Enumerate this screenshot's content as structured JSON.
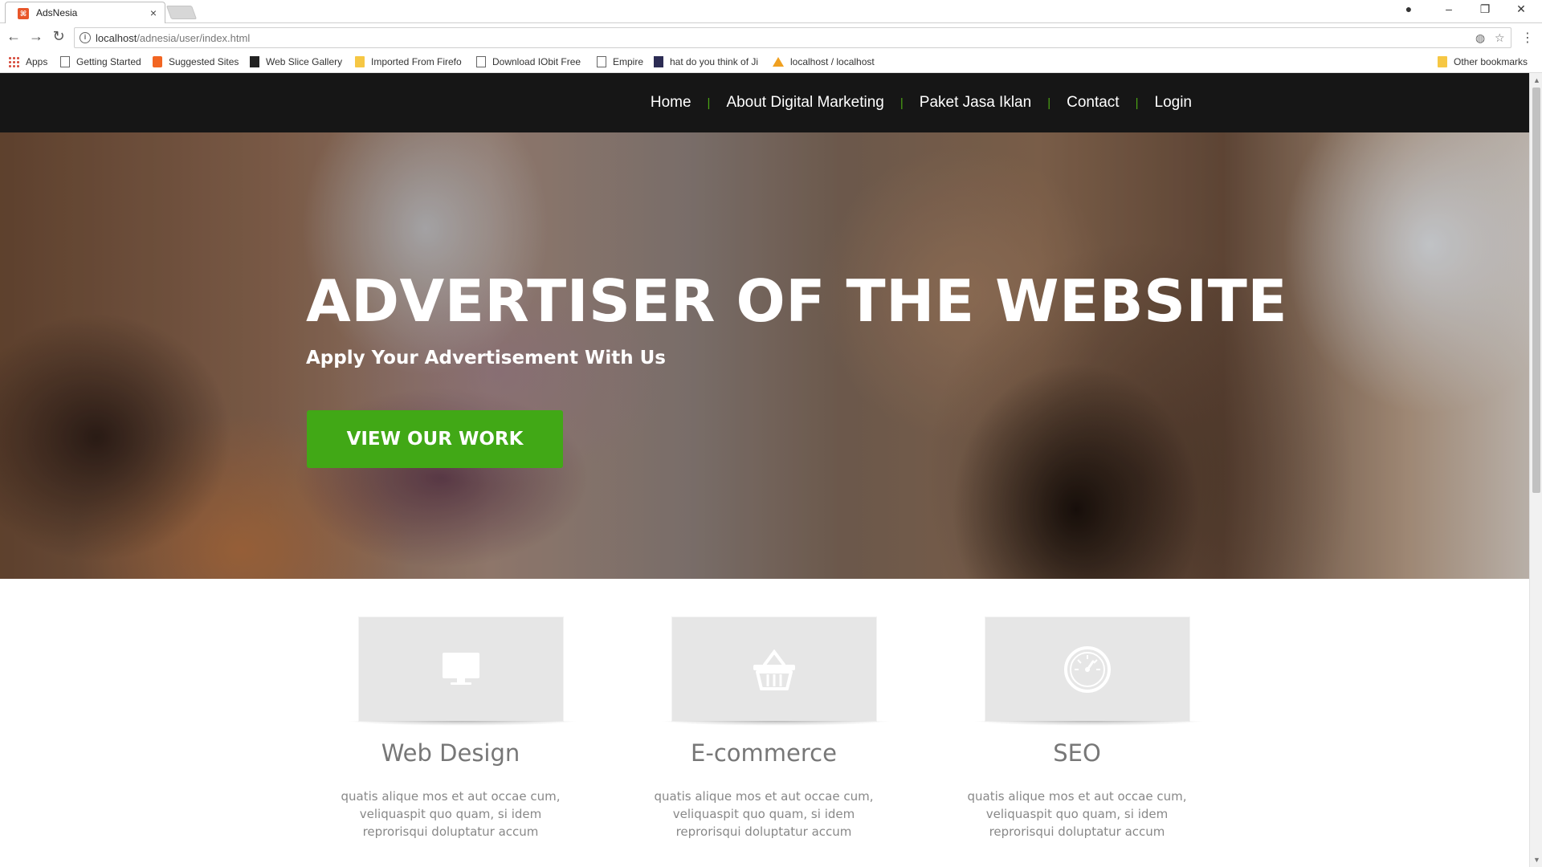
{
  "browser": {
    "tab_title": "AdsNesia",
    "tab_close": "×",
    "url_host": "localhost",
    "url_path": "/adnesia/user/index.html",
    "bookmarks": [
      {
        "label": "Apps",
        "icon": "apps-icon"
      },
      {
        "label": "Getting Started",
        "icon": "page-icon"
      },
      {
        "label": "Suggested Sites",
        "icon": "suggested-sites-icon"
      },
      {
        "label": "Web Slice Gallery",
        "icon": "web-slice-icon"
      },
      {
        "label": "Imported From Firefo",
        "icon": "folder-icon"
      },
      {
        "label": "Download IObit Free",
        "icon": "page-icon"
      },
      {
        "label": "Empire",
        "icon": "page-icon"
      },
      {
        "label": "hat do you think of Ji",
        "icon": "site-icon"
      },
      {
        "label": "localhost / localhost",
        "icon": "phpmyadmin-icon"
      }
    ],
    "other_bookmarks": "Other bookmarks"
  },
  "nav": {
    "items": [
      "Home",
      "About Digital Marketing",
      "Paket Jasa Iklan",
      "Contact",
      "Login"
    ],
    "separator": "|"
  },
  "hero": {
    "title": "ADVERTISER OF THE WEBSITE",
    "subtitle": "Apply Your Advertisement With Us",
    "button": "VIEW OUR WORK"
  },
  "services": [
    {
      "title": "Web Design",
      "icon": "monitor-icon",
      "text": "quatis alique mos et aut occae cum, veliquaspit quo quam, si idem reprorisqui doluptatur accum"
    },
    {
      "title": "E-commerce",
      "icon": "basket-icon",
      "text": "quatis alique mos et aut occae cum, veliquaspit quo quam, si idem reprorisqui doluptatur accum"
    },
    {
      "title": "SEO",
      "icon": "gauge-icon",
      "text": "quatis alique mos et aut occae cum, veliquaspit quo quam, si idem reprorisqui doluptatur accum"
    }
  ],
  "colors": {
    "nav_bg": "#161616",
    "accent_green": "#41a816",
    "separator_green": "#4ca514"
  }
}
